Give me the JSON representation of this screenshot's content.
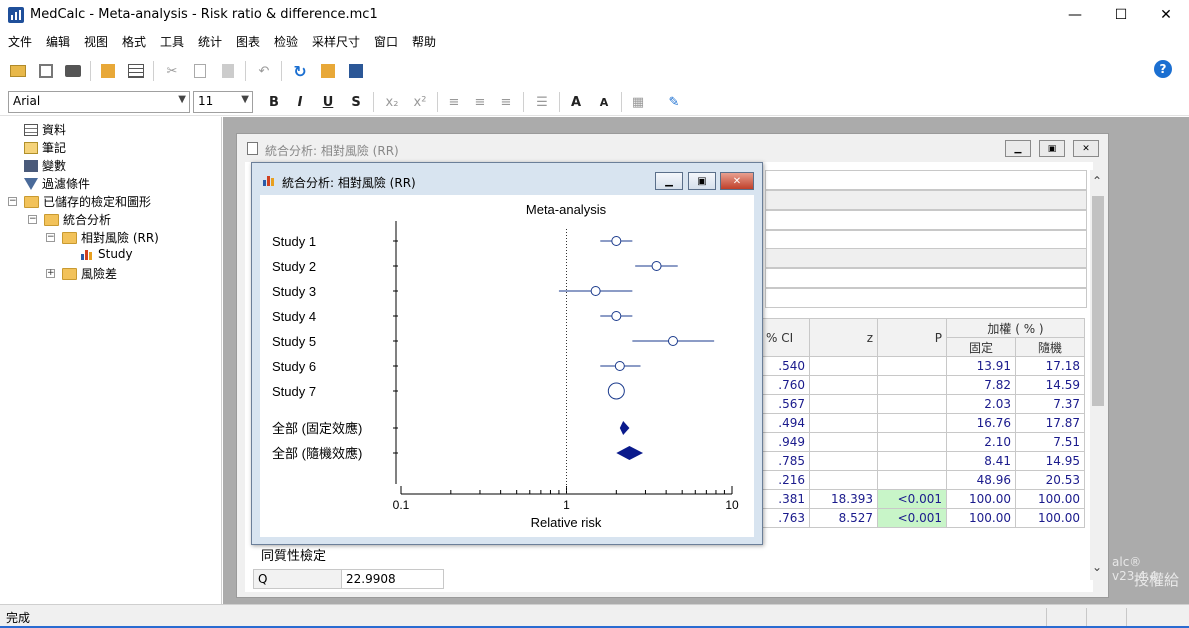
{
  "window": {
    "title": "MedCalc - Meta-analysis - Risk ratio & difference.mc1",
    "minimize": "—",
    "maximize": "☐",
    "close": "✕"
  },
  "menu": [
    "文件",
    "编辑",
    "视图",
    "格式",
    "工具",
    "统计",
    "图表",
    "检验",
    "采样尺寸",
    "窗口",
    "帮助"
  ],
  "format_toolbar": {
    "font": "Arial",
    "size": "11",
    "bold": "B",
    "italic": "I",
    "underline": "U",
    "strike": "S",
    "subscript": "x₂",
    "superscript": "x²"
  },
  "tree": {
    "items": [
      "資料",
      "筆記",
      "變數",
      "過濾條件",
      "已儲存的檢定和圖形",
      "統合分析",
      "相對風險 (RR)",
      "Study",
      "風險差"
    ]
  },
  "back_window": {
    "title": "統合分析: 相對風險 (RR)",
    "header_partial": "% CI",
    "col_z": "z",
    "col_p": "P",
    "col_weight": "加權 ( % )",
    "col_fixed": "固定",
    "col_random": "隨機",
    "rows": [
      {
        "ci": ".540",
        "z": "",
        "p": "",
        "fixed": "13.91",
        "random": "17.18"
      },
      {
        "ci": ".760",
        "z": "",
        "p": "",
        "fixed": "7.82",
        "random": "14.59"
      },
      {
        "ci": ".567",
        "z": "",
        "p": "",
        "fixed": "2.03",
        "random": "7.37"
      },
      {
        "ci": ".494",
        "z": "",
        "p": "",
        "fixed": "16.76",
        "random": "17.87"
      },
      {
        "ci": ".949",
        "z": "",
        "p": "",
        "fixed": "2.10",
        "random": "7.51"
      },
      {
        "ci": ".785",
        "z": "",
        "p": "",
        "fixed": "8.41",
        "random": "14.95"
      },
      {
        "ci": ".216",
        "z": "",
        "p": "",
        "fixed": "48.96",
        "random": "20.53"
      },
      {
        "ci": ".381",
        "z": "18.393",
        "p": "<0.001",
        "fixed": "100.00",
        "random": "100.00"
      },
      {
        "ci": ".763",
        "z": "8.527",
        "p": "<0.001",
        "fixed": "100.00",
        "random": "100.00"
      }
    ],
    "heterogeneity_title": "同質性檢定",
    "q_label": "Q",
    "q_value": "22.9908",
    "watermark_version": "alc® v23.4.4",
    "watermark_license": "授權給"
  },
  "front_window": {
    "title": "統合分析: 相對風險 (RR)"
  },
  "chart_data": {
    "type": "forest",
    "title": "Meta-analysis",
    "xlabel": "Relative risk",
    "x_scale": "log",
    "xlim": [
      0.1,
      10
    ],
    "xticks": [
      "0.1",
      "1",
      "10"
    ],
    "reference_line": 1,
    "studies": [
      {
        "label": "Study 1",
        "rr": 2.0,
        "lo": 1.6,
        "hi": 2.5
      },
      {
        "label": "Study 2",
        "rr": 3.5,
        "lo": 2.6,
        "hi": 4.7
      },
      {
        "label": "Study 3",
        "rr": 1.5,
        "lo": 0.9,
        "hi": 2.5
      },
      {
        "label": "Study 4",
        "rr": 2.0,
        "lo": 1.6,
        "hi": 2.5
      },
      {
        "label": "Study 5",
        "rr": 4.4,
        "lo": 2.5,
        "hi": 7.8
      },
      {
        "label": "Study 6",
        "rr": 2.1,
        "lo": 1.6,
        "hi": 2.8
      },
      {
        "label": "Study 7",
        "rr": 2.0,
        "lo": 1.9,
        "hi": 2.1
      }
    ],
    "pooled": [
      {
        "label": "全部 (固定效應)",
        "rr": 2.2,
        "lo": 2.1,
        "hi": 2.4
      },
      {
        "label": "全部 (隨機效應)",
        "rr": 2.4,
        "lo": 2.0,
        "hi": 2.9
      }
    ],
    "colors": {
      "marker": "#1a3a8c",
      "diamond": "#0a1a8c"
    }
  },
  "status": {
    "text": "完成"
  }
}
